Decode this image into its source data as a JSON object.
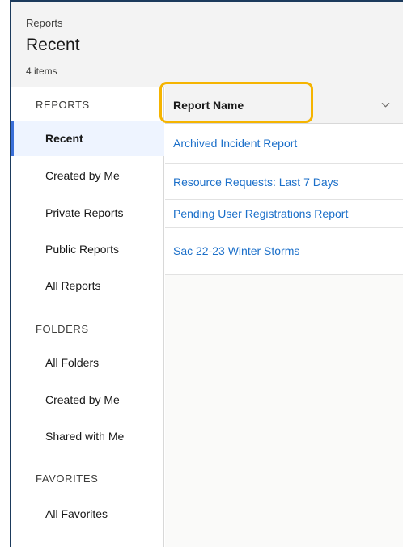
{
  "header": {
    "breadcrumb": "Reports",
    "title": "Recent",
    "item_count": "4 items"
  },
  "sidebar": {
    "sections": [
      {
        "title": "REPORTS",
        "items": [
          "Recent",
          "Created by Me",
          "Private Reports",
          "Public Reports",
          "All Reports"
        ]
      },
      {
        "title": "FOLDERS",
        "items": [
          "All Folders",
          "Created by Me",
          "Shared with Me"
        ]
      },
      {
        "title": "FAVORITES",
        "items": [
          "All Favorites"
        ]
      }
    ],
    "active_item": "Recent"
  },
  "table": {
    "column_header": "Report Name",
    "rows": [
      "Archived Incident Report",
      "Resource Requests: Last 7 Days",
      "Pending User Registrations Report",
      "Sac 22-23 Winter Storms"
    ]
  },
  "colors": {
    "link": "#1b6fc9",
    "highlight": "#f5b400",
    "active_bar": "#3a6fd8",
    "header_bg": "#f3f3f3"
  }
}
